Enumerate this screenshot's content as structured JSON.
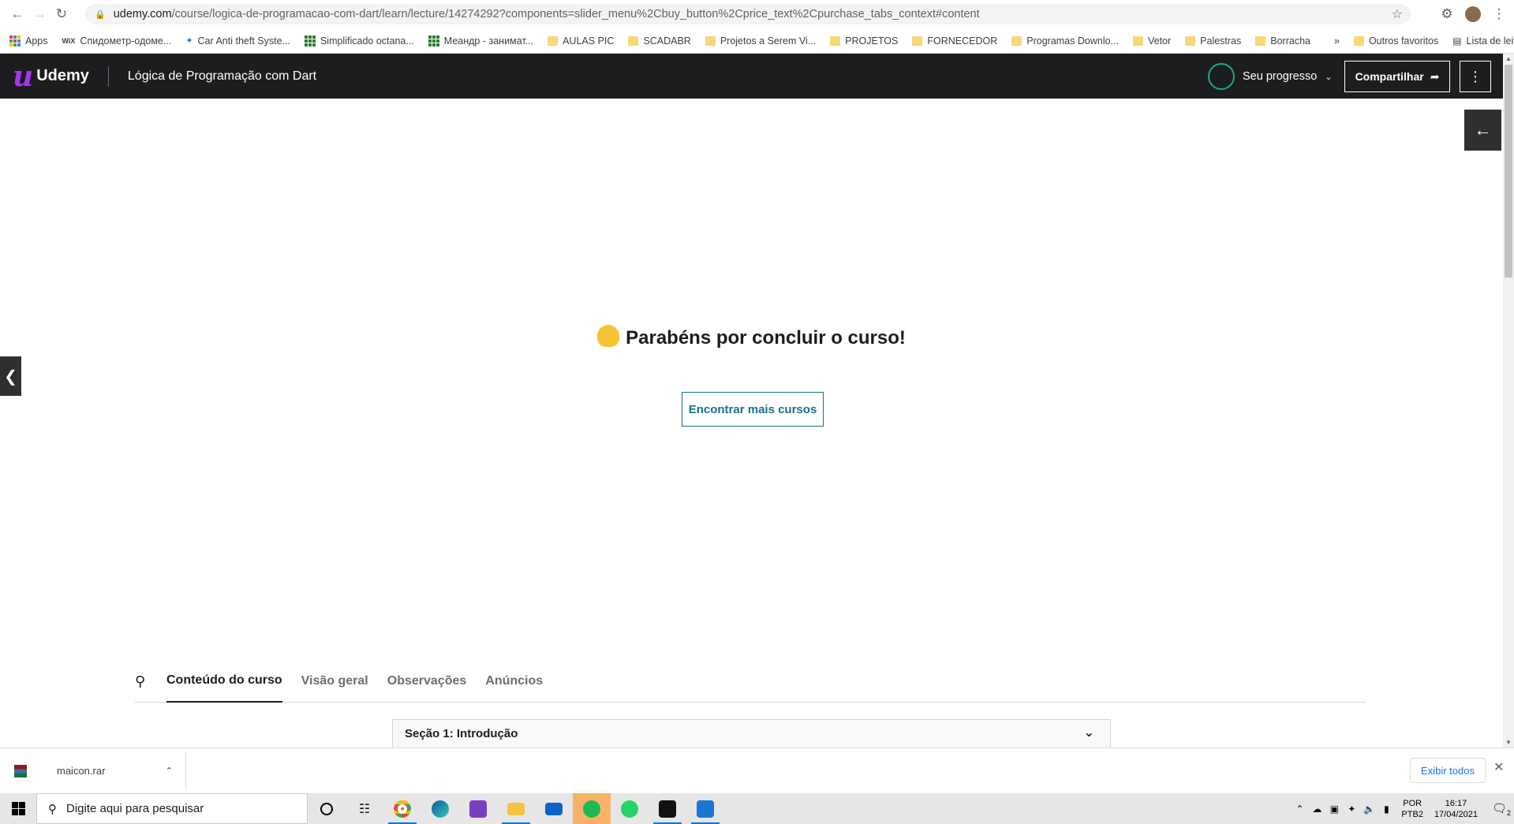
{
  "browser": {
    "url_host": "udemy.com",
    "url_path": "/course/logica-de-programacao-com-dart/learn/lecture/14274292?components=slider_menu%2Cbuy_button%2Cprice_text%2Cpurchase_tabs_context#content",
    "bookmarks": [
      {
        "label": "Apps",
        "icon": "apps-grid-icon"
      },
      {
        "label": "Спидометр-одоме...",
        "icon": "wix-icon"
      },
      {
        "label": "Car Anti theft Syste...",
        "icon": "site-icon"
      },
      {
        "label": "Simplificado octana...",
        "icon": "grid-site-icon"
      },
      {
        "label": "Меандр - занимат...",
        "icon": "grid-site-icon"
      },
      {
        "label": "AULAS PIC",
        "icon": "folder-icon"
      },
      {
        "label": "SCADABR",
        "icon": "folder-icon"
      },
      {
        "label": "Projetos a Serem Vi...",
        "icon": "folder-icon"
      },
      {
        "label": "PROJETOS",
        "icon": "folder-icon"
      },
      {
        "label": "FORNECEDOR",
        "icon": "folder-icon"
      },
      {
        "label": "Programas Downlo...",
        "icon": "folder-icon"
      },
      {
        "label": "Vetor",
        "icon": "folder-icon"
      },
      {
        "label": "Palestras",
        "icon": "folder-icon"
      },
      {
        "label": "Borracha",
        "icon": "folder-icon"
      }
    ],
    "more_bookmarks": "»",
    "other_favorites": "Outros favoritos",
    "reading_list": "Lista de leitura"
  },
  "header": {
    "logo_text": "Udemy",
    "course_title": "Lógica de Programação com Dart",
    "progress_label": "Seu progresso",
    "share_label": "Compartilhar",
    "accent_color": "#a435f0",
    "progress_color": "#1ea880"
  },
  "main": {
    "congrats_text": "Parabéns por concluir o curso!",
    "find_more_label": "Encontrar mais cursos",
    "tabs": [
      {
        "label": "Conteúdo do curso",
        "active": true
      },
      {
        "label": "Visão geral",
        "active": false
      },
      {
        "label": "Observações",
        "active": false
      },
      {
        "label": "Anúncios",
        "active": false
      }
    ],
    "section_title": "Seção 1: Introdução"
  },
  "downloads": {
    "file_name": "maicon.rar",
    "show_all_label": "Exibir todos"
  },
  "taskbar": {
    "search_placeholder": "Digite aqui para pesquisar",
    "lang_line1": "POR",
    "lang_line2": "PTB2",
    "time": "16:17",
    "date": "17/04/2021",
    "notification_count": "2"
  }
}
